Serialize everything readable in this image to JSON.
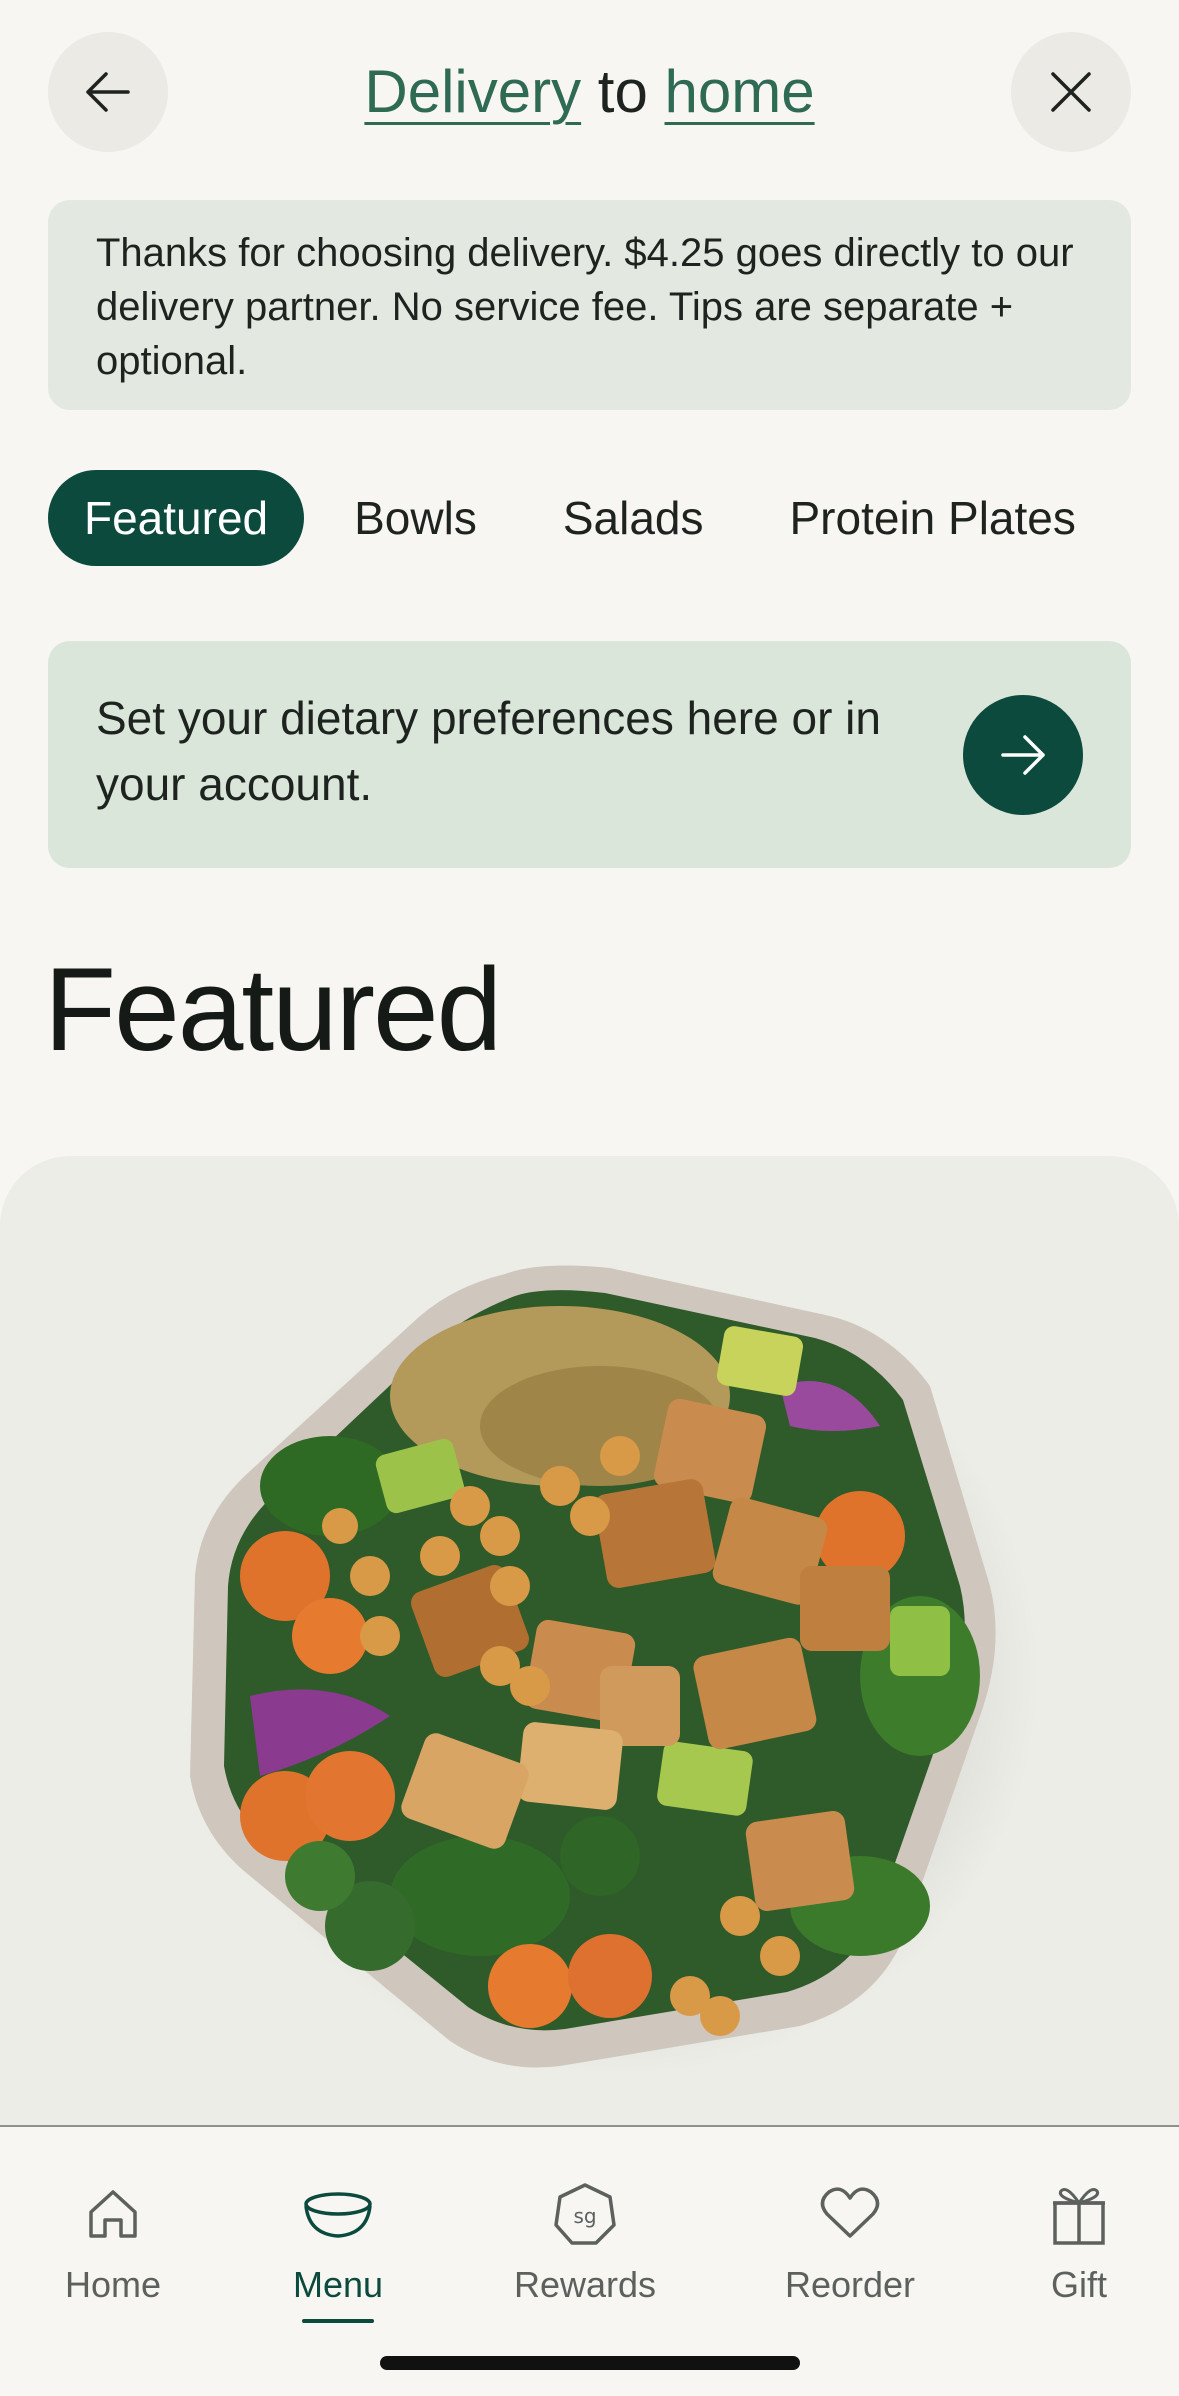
{
  "header": {
    "title_link1": "Delivery",
    "title_mid": "to",
    "title_link2": "home"
  },
  "notice": {
    "text": "Thanks for choosing delivery. $4.25 goes directly to our delivery partner. No service fee. Tips are separate + optional."
  },
  "tabs": [
    {
      "label": "Featured",
      "active": true
    },
    {
      "label": "Bowls",
      "active": false
    },
    {
      "label": "Salads",
      "active": false
    },
    {
      "label": "Protein Plates",
      "active": false
    }
  ],
  "dietary_banner": {
    "text": "Set your dietary preferences here or in your account."
  },
  "section": {
    "title": "Featured"
  },
  "bottom_nav": {
    "items": [
      {
        "label": "Home",
        "icon": "home-icon"
      },
      {
        "label": "Menu",
        "icon": "bowl-icon",
        "active": true
      },
      {
        "label": "Rewards",
        "icon": "sg-rewards-icon"
      },
      {
        "label": "Reorder",
        "icon": "heart-icon"
      },
      {
        "label": "Gift",
        "icon": "gift-icon"
      }
    ],
    "rewards_badge_text": "sg"
  },
  "colors": {
    "brand_dark_green": "#0b4a3d",
    "link_green": "#2f6b54",
    "notice_bg": "#e3e8e1",
    "diet_bg": "#dae6da",
    "page_bg": "#f7f6f2"
  }
}
